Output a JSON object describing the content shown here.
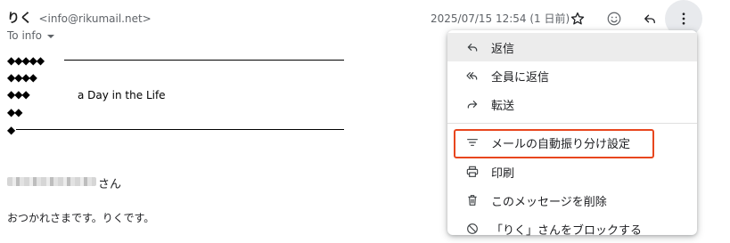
{
  "header": {
    "sender_name": "りく",
    "sender_email": "<info@rikumail.net>",
    "to_label": "To info",
    "date": "2025/07/15 12:54 (1 日前)",
    "icons": [
      "star-icon",
      "emoji-icon",
      "reply-icon",
      "more-vert-icon"
    ]
  },
  "body": {
    "diamond_rows": [
      "◆◆◆◆◆",
      "◆◆◆◆",
      "◆◆◆",
      "◆◆",
      "◆"
    ],
    "song_title": "a Day in the Life",
    "name_suffix": "さん",
    "greeting": "おつかれさまです。りくです。"
  },
  "menu": {
    "items": [
      {
        "label": "返信",
        "icon": "reply-icon"
      },
      {
        "label": "全員に返信",
        "icon": "reply-all-icon"
      },
      {
        "label": "転送",
        "icon": "forward-icon"
      },
      {
        "label": "メールの自動振り分け設定",
        "icon": "filter-icon"
      },
      {
        "label": "印刷",
        "icon": "print-icon"
      },
      {
        "label": "このメッセージを削除",
        "icon": "trash-icon"
      },
      {
        "label": "「りく」さんをブロックする",
        "icon": "block-icon"
      }
    ]
  },
  "colors": {
    "highlight": "#e8461e",
    "hover_row": "#ececec",
    "more_button_bg": "#e8eaed"
  }
}
